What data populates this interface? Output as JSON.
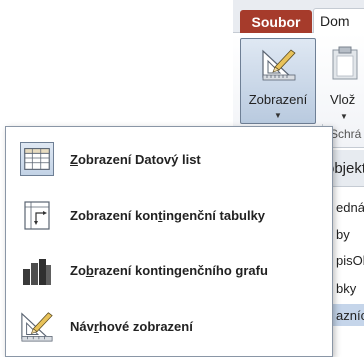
{
  "ribbon": {
    "tabs": [
      {
        "label": "Soubor"
      },
      {
        "label": "Dom"
      }
    ],
    "view_button": {
      "label": "Zobrazení",
      "icon": "design-view-icon"
    },
    "paste_button": {
      "label": "Vlož",
      "icon": "clipboard-icon"
    },
    "group_label": "Schrá"
  },
  "navigation_pane": {
    "header": "objekt",
    "items": [
      "ednávk",
      "by",
      "pisObje",
      "bky",
      "azníci"
    ]
  },
  "view_menu": {
    "items": [
      {
        "label_pre": "",
        "mnemonic": "Z",
        "label_post": "obrazení Datový list",
        "icon": "datasheet-view-icon"
      },
      {
        "label_pre": "Zobrazení kon",
        "mnemonic": "t",
        "label_post": "ingenční tabulky",
        "icon": "pivot-table-view-icon"
      },
      {
        "label_pre": "Zo",
        "mnemonic": "b",
        "label_post": "razení kontingenčního grafu",
        "icon": "pivot-chart-view-icon"
      },
      {
        "label_pre": "Náv",
        "mnemonic": "r",
        "label_post": "hové zobrazení",
        "icon": "design-view-icon"
      }
    ]
  },
  "colors": {
    "file_tab": "#a63b2b",
    "selected_button": "#b9cadf",
    "selected_item": "#c5d5ea"
  }
}
